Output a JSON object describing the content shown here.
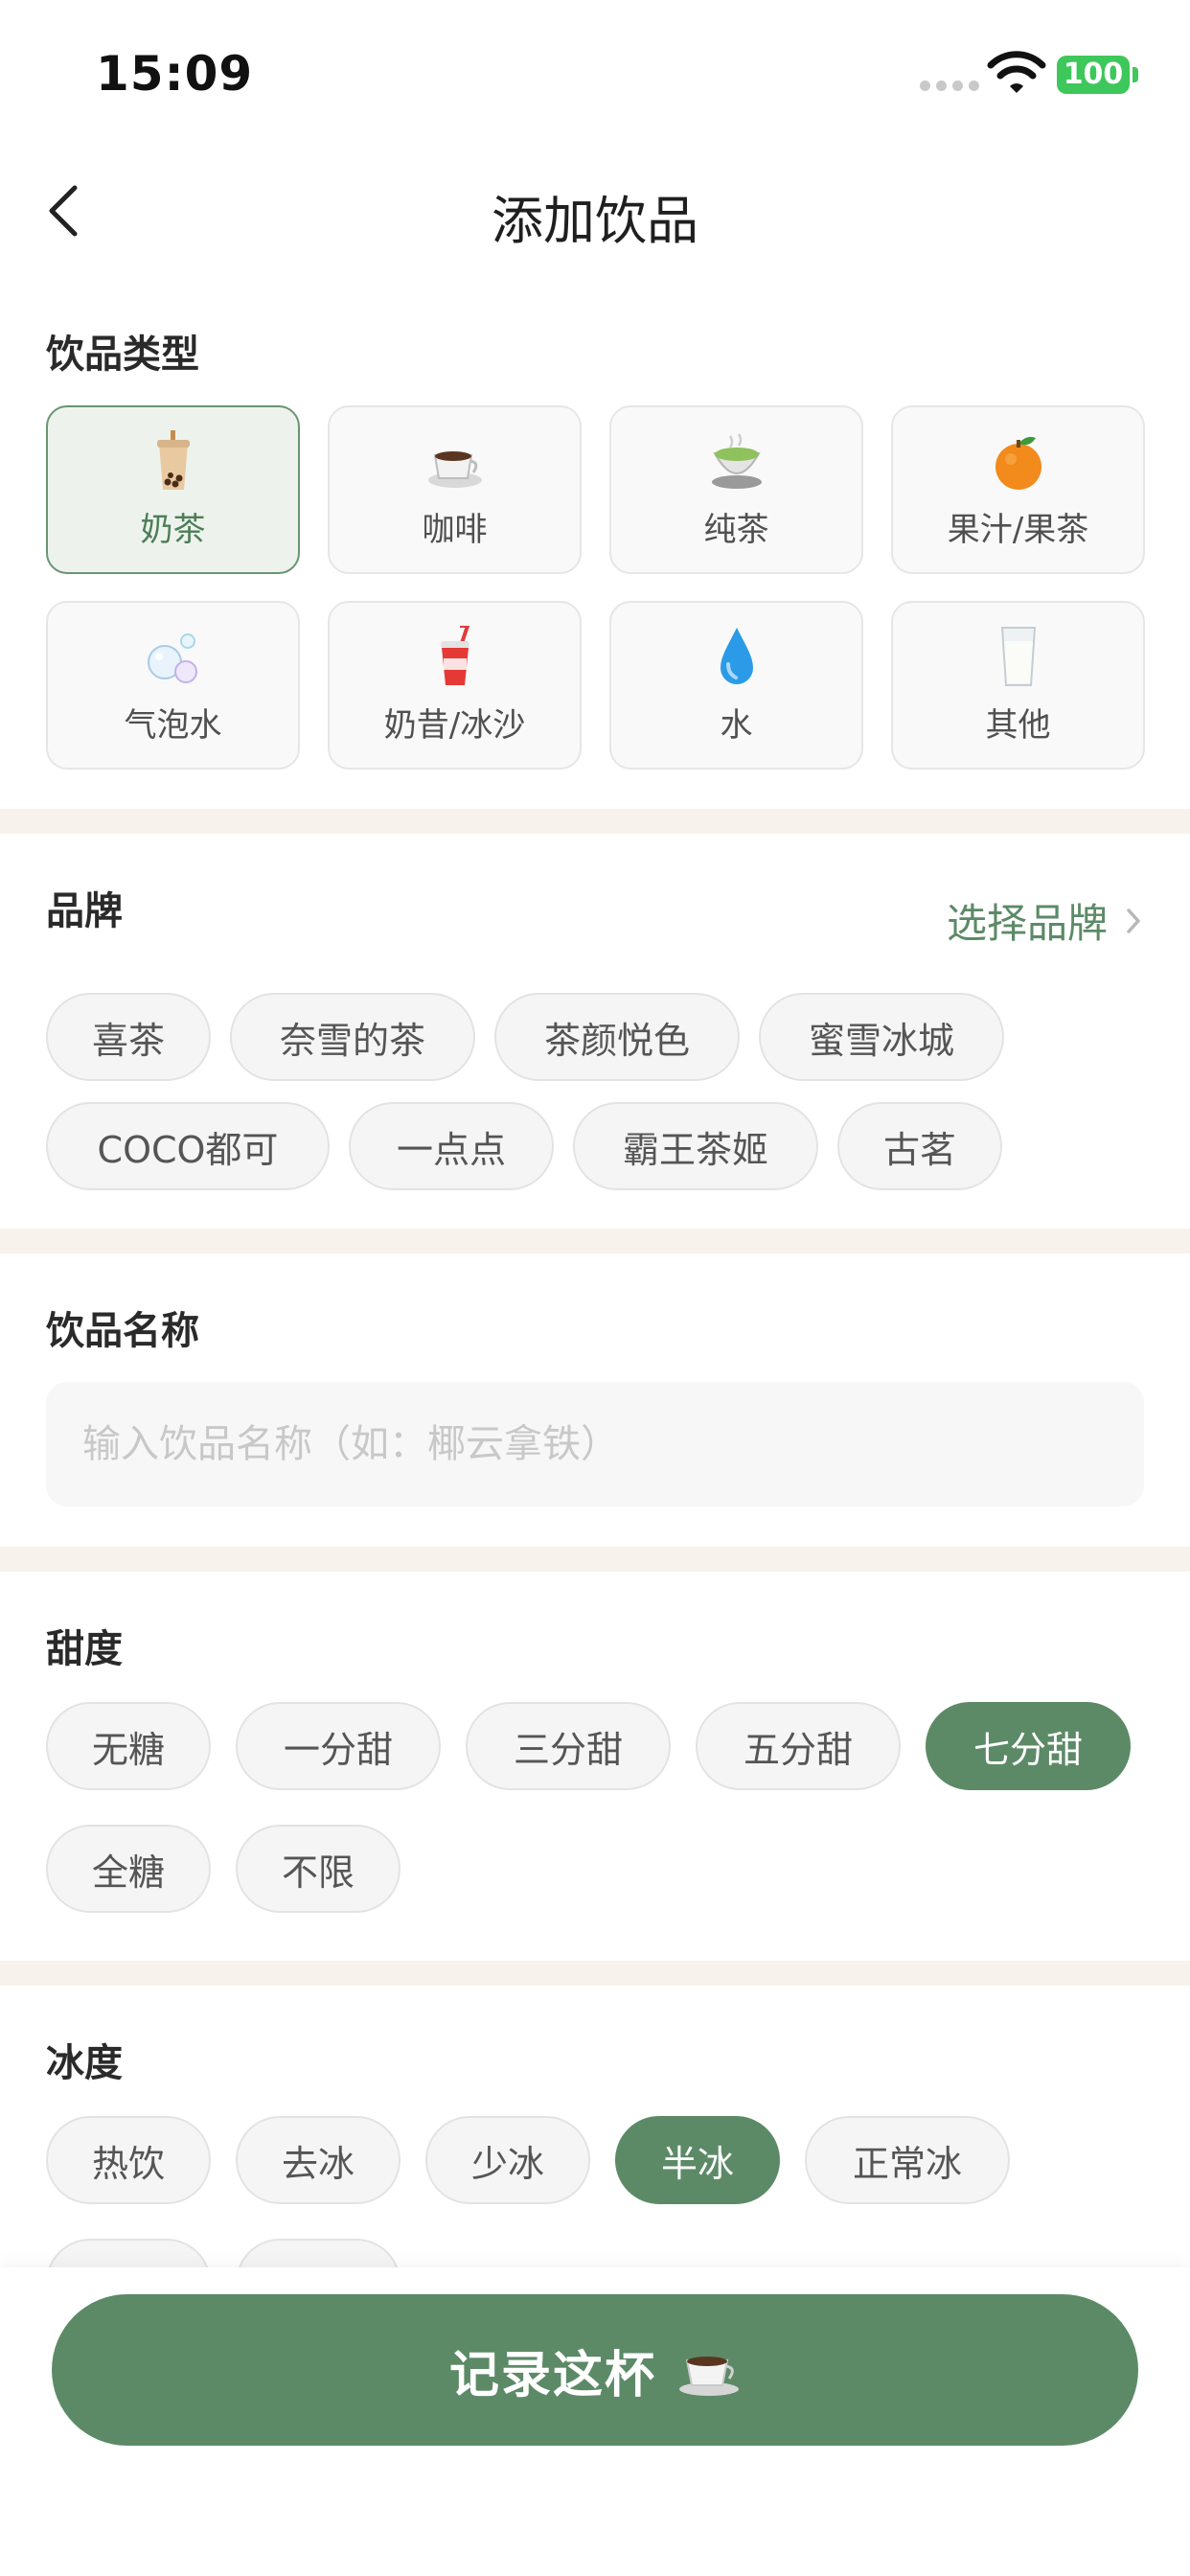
{
  "status_bar": {
    "time": "15:09",
    "battery": "100"
  },
  "nav": {
    "title": "添加饮品",
    "back_icon": "chevron-left-icon"
  },
  "drink_type": {
    "title": "饮品类型",
    "selected": "奶茶",
    "options": [
      {
        "label": "奶茶",
        "icon": "bubble-tea-icon"
      },
      {
        "label": "咖啡",
        "icon": "coffee-cup-icon"
      },
      {
        "label": "纯茶",
        "icon": "green-tea-icon"
      },
      {
        "label": "果汁/果茶",
        "icon": "orange-icon"
      },
      {
        "label": "气泡水",
        "icon": "bubbles-icon"
      },
      {
        "label": "奶昔/冰沙",
        "icon": "cup-with-straw-icon"
      },
      {
        "label": "水",
        "icon": "water-drop-icon"
      },
      {
        "label": "其他",
        "icon": "glass-of-milk-icon"
      }
    ]
  },
  "brand": {
    "title": "品牌",
    "select_label": "选择品牌",
    "options": [
      "喜茶",
      "奈雪的茶",
      "茶颜悦色",
      "蜜雪冰城",
      "COCO都可",
      "一点点",
      "霸王茶姬",
      "古茗"
    ]
  },
  "drink_name": {
    "title": "饮品名称",
    "placeholder": "输入饮品名称（如：椰云拿铁）",
    "value": ""
  },
  "sweetness": {
    "title": "甜度",
    "selected": "七分甜",
    "options": [
      "无糖",
      "一分甜",
      "三分甜",
      "五分甜",
      "七分甜",
      "全糖",
      "不限"
    ]
  },
  "ice": {
    "title": "冰度",
    "selected": "半冰",
    "options": [
      "热饮",
      "去冰",
      "少冰",
      "半冰",
      "正常冰"
    ]
  },
  "record_button": {
    "label": "记录这杯",
    "icon": "hot-beverage-icon"
  },
  "colors": {
    "accent": "#5c8a67",
    "selected_card_bg": "#edf3ec",
    "divider": "#f7f2ec",
    "battery": "#3ec75a"
  }
}
